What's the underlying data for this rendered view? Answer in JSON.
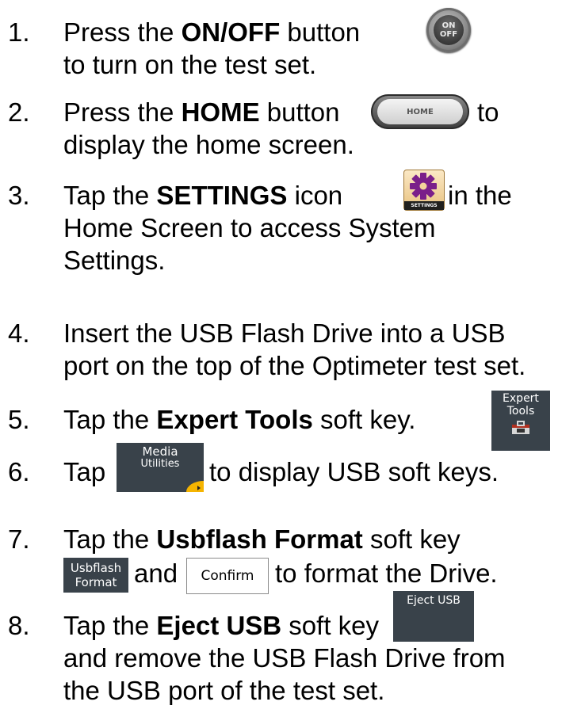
{
  "steps": [
    {
      "number": "1.",
      "lines": [
        {
          "a": "Press the ",
          "b": "ON/OFF",
          "c": " button"
        },
        {
          "text": "to turn on the test set."
        }
      ],
      "button_label": [
        "ON",
        "OFF"
      ]
    },
    {
      "number": "2.",
      "lines": [
        {
          "a": "Press the ",
          "b": "HOME",
          "c": " button",
          "d": "to"
        },
        {
          "text": "display the home screen."
        }
      ],
      "button_label": "HOME"
    },
    {
      "number": "3.",
      "lines": [
        {
          "a": "Tap the ",
          "b": "SETTINGS",
          "c": " icon",
          "d": "in the"
        },
        {
          "text": "Home Screen to access System"
        },
        {
          "text": "Settings."
        }
      ],
      "icon_caption": "SETTINGS"
    },
    {
      "number": "4.",
      "lines": [
        {
          "text": "Insert the USB Flash Drive into a USB"
        },
        {
          "text": "port on the top of the Optimeter test set."
        }
      ]
    },
    {
      "number": "5.",
      "lines": [
        {
          "a": "Tap the ",
          "b": "Expert Tools",
          "c": " soft key."
        }
      ],
      "softkey": [
        "Expert",
        "Tools"
      ]
    },
    {
      "number": "6.",
      "lines": [
        {
          "a": "Tap",
          "d": "to display USB soft keys."
        }
      ],
      "softkey": [
        "Media",
        "Utilities"
      ]
    },
    {
      "number": "7.",
      "lines": [
        {
          "a": "Tap the ",
          "b": "Usbflash Format",
          "c": " soft key"
        },
        {
          "a": "and",
          "d": "to format the Drive."
        }
      ],
      "softkey": [
        "Usbflash",
        "Format"
      ],
      "confirm_label": "Confirm"
    },
    {
      "number": "8.",
      "lines": [
        {
          "a": "Tap the ",
          "b": "Eject USB",
          "c": " soft key"
        },
        {
          "text": "and remove the USB Flash Drive from"
        },
        {
          "text": "the USB port of the test set."
        }
      ],
      "softkey": [
        "Eject USB"
      ]
    }
  ],
  "colors": {
    "softkey_bg": "#39424a",
    "settings_icon_bg": "#e8c27f",
    "gear": "#7a1f8a",
    "accent_yellow": "#f5b400"
  }
}
